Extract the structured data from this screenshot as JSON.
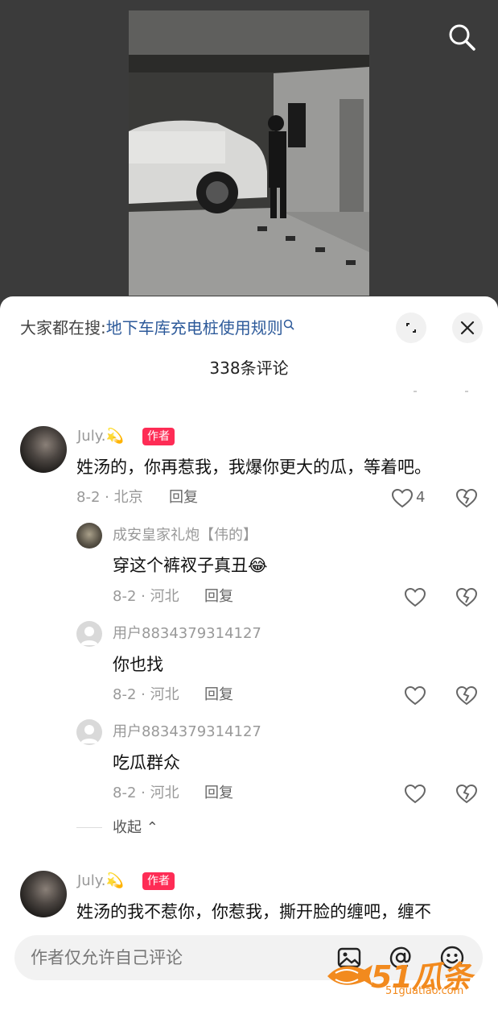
{
  "video": {
    "search_icon": "search-icon"
  },
  "header": {
    "hot_search_lead": "大家都在搜:",
    "hot_search_link": "地下车库充电桩使用规则",
    "comment_count": "338条评论"
  },
  "comments": [
    {
      "author": "July.💫",
      "tag": "作者",
      "text": "姓汤的，你再惹我，我爆你更大的瓜，等着吧。",
      "meta": "8-2 · 北京",
      "reply": "回复",
      "likes": "4",
      "replies": [
        {
          "author": "成安皇家礼炮【伟的】",
          "text": "穿这个裤衩子真丑😂",
          "meta": "8-2 · 河北",
          "reply": "回复"
        },
        {
          "author": "用户8834379314127",
          "text": "你也找",
          "meta": "8-2 · 河北",
          "reply": "回复"
        },
        {
          "author": "用户8834379314127",
          "text": "吃瓜群众",
          "meta": "8-2 · 河北",
          "reply": "回复"
        }
      ],
      "collapse": "收起 ⌃"
    },
    {
      "author": "July.💫",
      "tag": "作者",
      "text": "姓汤的我不惹你，你惹我，撕开脸的缠吧，缠不"
    }
  ],
  "input": {
    "placeholder": "作者仅允许自己评论"
  },
  "watermark": {
    "main": "51瓜条",
    "sub": "51guatiao.com"
  },
  "colors": {
    "link": "#2d5a9a",
    "author_tag": "#fe2c55",
    "watermark": "#f28a1e"
  }
}
